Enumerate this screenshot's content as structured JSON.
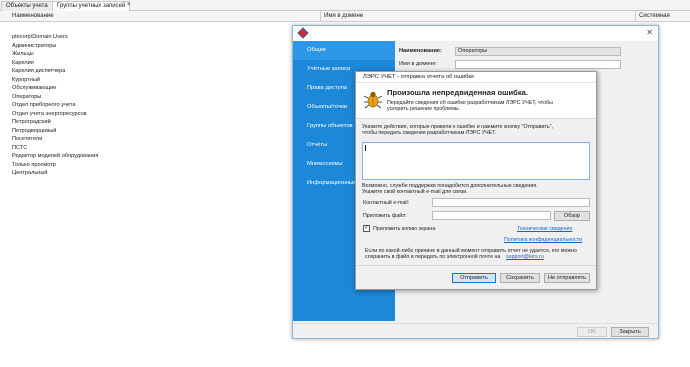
{
  "tabs": [
    {
      "label": "Объекты учета"
    },
    {
      "label": "Группы учетных записей"
    }
  ],
  "grid": {
    "columns": [
      "Наименование",
      "Имя в домене",
      "Системная"
    ],
    "rows": [
      "ptecorp\\Domain Users",
      "Администраторы",
      "Жильцы",
      "Карелия",
      "Карелия диспетчера",
      "Курортный",
      "Обслуживающие",
      "Операторы",
      "Отдел приборного учета",
      "Отдел учета энергоресурсов",
      "Петроградский",
      "Петродворцовый",
      "Посетители",
      "ПСТС",
      "Редактор моделей оборудования",
      "Только просмотр",
      "Центральный"
    ]
  },
  "settings_window": {
    "nav": [
      "Общие",
      "Учётные записи",
      "Права доступа",
      "Объекты/точки",
      "Группы объектов",
      "Отчёты",
      "Мнемосхемы",
      "Информационные п"
    ],
    "name_label": "Наименование:",
    "name_value": "Операторы",
    "domain_label": "Имя в домене:",
    "ok_label": "OK",
    "close_label": "Закрыть"
  },
  "error_dialog": {
    "title": "ЛЭРС УЧЕТ - отправка отчета об ошибке",
    "headline": "Произошла непредвиденная ошибка.",
    "subtext_1": "Передайте сведения об ошибке разработчикам ЛЭРС УЧЕТ, чтобы",
    "subtext_2": "ускорить решение проблемы.",
    "instr_1": "Укажите действия, которые привели к ошибке и нажмите кнопку \"Отправить\",",
    "instr_2": "чтобы передать сведения разработчикам ЛЭРС УЧЕТ.",
    "support_1": "Возможно, службе поддержки понадобится дополнительные сведения.",
    "support_2": "Укажите свой контактный e-mail для связи.",
    "email_label": "Контактный e-mail:",
    "file_label": "Приложить файл:",
    "browse_label": "Обзор",
    "attach_label": "Приложить копию экрана",
    "tech_link": "Технические сведения",
    "privacy_link": "Политика конфиденциальности",
    "note_1": "Если по какой-либо причине в данный момент отправить отчет не удается, его можно",
    "note_2": "сохранить в файл и передать по электронной почте на",
    "support_email": "support@lers.ru",
    "send_label": "Отправить",
    "save_label": "Сохранить",
    "nosend_label": "Не отправлять"
  }
}
